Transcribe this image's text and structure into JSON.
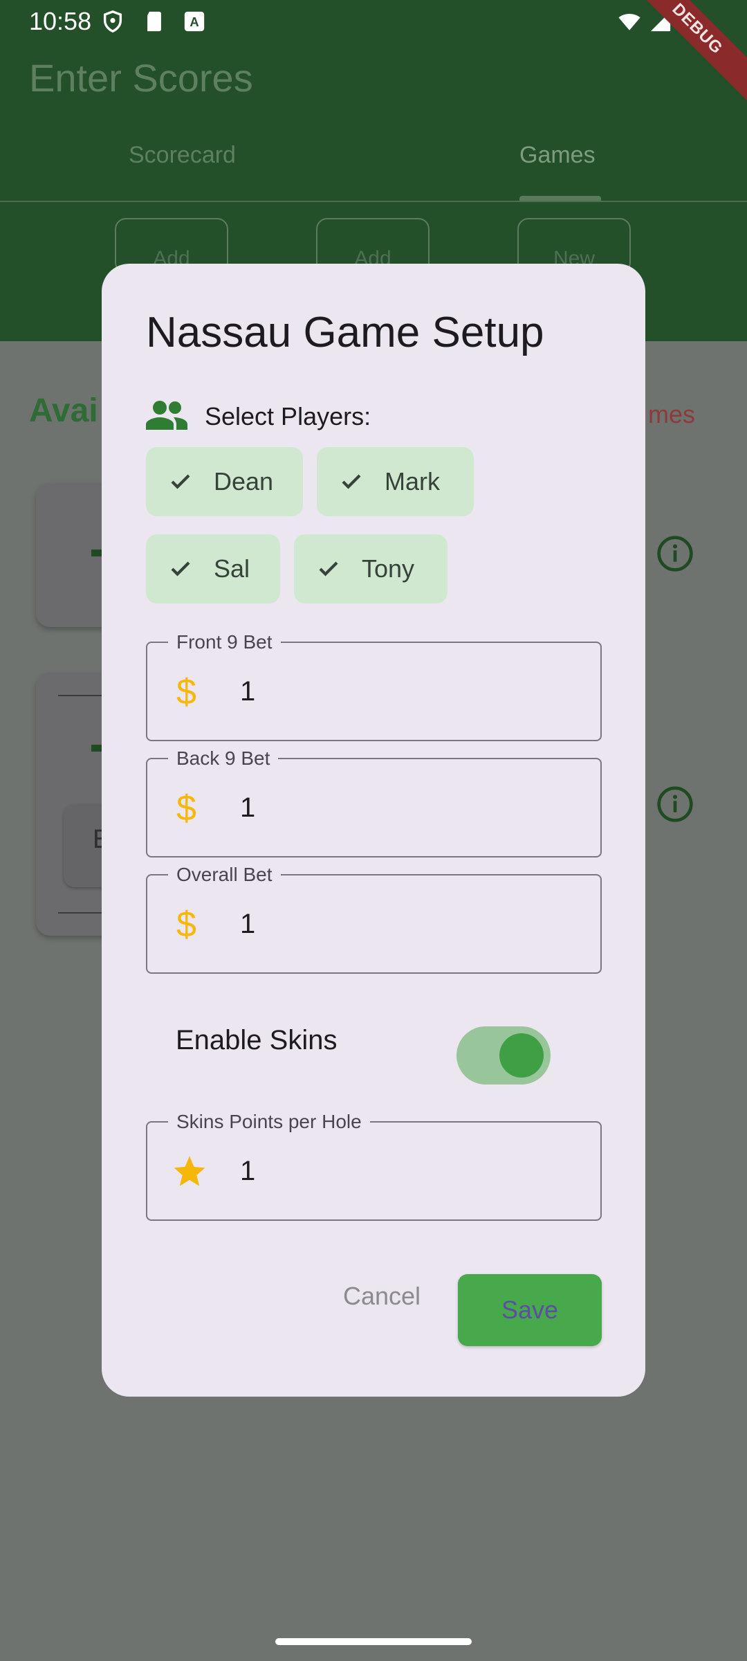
{
  "status_bar": {
    "time": "10:58",
    "icons": [
      "shield-icon",
      "sd-card-icon",
      "a-icon",
      "wifi-icon",
      "signal-icon",
      "battery-icon"
    ]
  },
  "debug_banner": "DEBUG",
  "app": {
    "title": "Enter Scores",
    "tabs": [
      {
        "label": "Scorecard",
        "active": false
      },
      {
        "label": "Games",
        "active": true
      }
    ],
    "action_buttons": [
      "Add",
      "Add",
      "New"
    ],
    "section_title": "Avai",
    "section_link": "mes",
    "card_partial_text": "E"
  },
  "dialog": {
    "title": "Nassau Game Setup",
    "players_label": "Select Players:",
    "players": [
      {
        "name": "Dean",
        "selected": true
      },
      {
        "name": "Mark",
        "selected": true
      },
      {
        "name": "Sal",
        "selected": true
      },
      {
        "name": "Tony",
        "selected": true
      }
    ],
    "fields": {
      "front9": {
        "label": "Front 9 Bet",
        "prefix": "$",
        "value": "1"
      },
      "back9": {
        "label": "Back 9 Bet",
        "prefix": "$",
        "value": "1"
      },
      "overall": {
        "label": "Overall Bet",
        "prefix": "$",
        "value": "1"
      },
      "skins_points": {
        "label": "Skins Points per Hole",
        "value": "1"
      }
    },
    "enable_skins": {
      "label": "Enable Skins",
      "on": true
    },
    "cancel_label": "Cancel",
    "save_label": "Save"
  },
  "colors": {
    "primary": "#47a84c",
    "appbar": "#235029",
    "dialog_bg": "#ece6f0",
    "chip_bg": "#d0e8d0",
    "accent_gold": "#f5b70a"
  }
}
